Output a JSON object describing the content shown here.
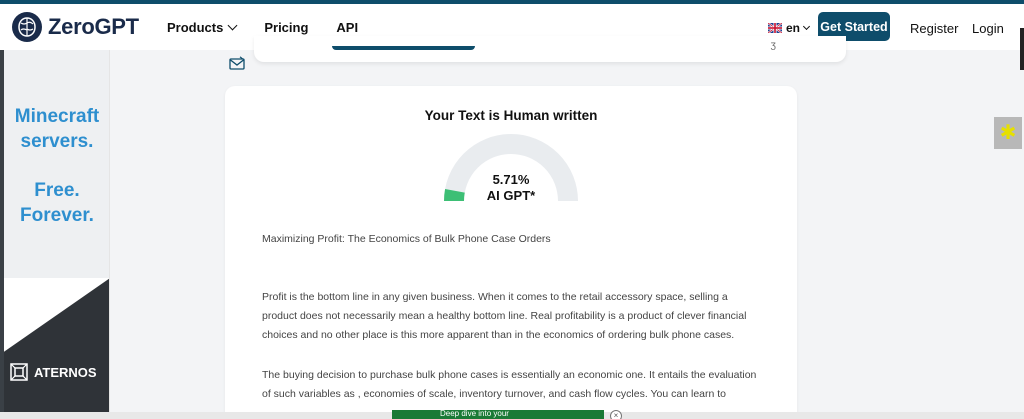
{
  "brand": {
    "name": "ZeroGPT"
  },
  "nav": {
    "items": [
      {
        "label": "Products",
        "has_dropdown": true
      },
      {
        "label": "Pricing",
        "has_dropdown": false
      },
      {
        "label": "API",
        "has_dropdown": false
      }
    ],
    "language": "en",
    "get_started_label": "Get Started",
    "register_label": "Register",
    "login_label": "Login"
  },
  "left_ad": {
    "headline": "Minecraft servers.",
    "subline": "Free. Forever.",
    "brand": "ATERNOS"
  },
  "result": {
    "title": "Your Text is Human written",
    "percentage": "5.71%",
    "label": "AI GPT*",
    "gauge_fraction": 0.0571
  },
  "text": {
    "title": "Maximizing Profit: The Economics of Bulk Phone Case Orders",
    "paragraph1": "Profit is the bottom line in any given business. When it comes to the retail accessory space, selling a product does not necessarily mean a healthy bottom line. Real profitability is a product of clever financial choices and no other place is this more apparent than in the economics of ordering bulk phone cases.",
    "paragraph2": "The buying decision to purchase bulk phone cases is essentially an economic one. It entails the evaluation of such variables as , economies of scale, inventory turnover, and cash flow cycles. You can learn to"
  },
  "colors": {
    "brand_dark": "#0e4d6b",
    "gauge_fill": "#3dbf75",
    "gauge_track": "#e9ecef",
    "ad_blue": "#2e8fcf"
  }
}
